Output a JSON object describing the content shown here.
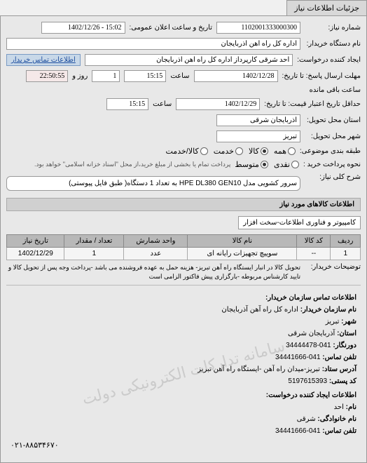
{
  "tab": {
    "title": "جزئیات اطلاعات نیاز"
  },
  "form": {
    "request_number_label": "شماره نیاز:",
    "request_number": "1102001333000300",
    "public_datetime_label": "تاریخ و ساعت اعلان عمومی:",
    "public_datetime": "15:02 - 1402/12/26",
    "buyer_org_label": "نام دستگاه خریدار:",
    "buyer_org": "اداره کل راه آهن آذربایجان",
    "requester_label": "ایجاد کننده درخواست:",
    "requester": "احد شرقی کارپرداز اداره کل راه آهن آذربایجان",
    "contact_link": "اطلاعات تماس خریدار",
    "response_deadline_label": "مهلت ارسال پاسخ: تا تاریخ:",
    "validity_deadline_label": "حداقل تاریخ اعتبار قیمت: تا تاریخ:",
    "date1": "1402/12/28",
    "date2": "1402/12/29",
    "time_label": "ساعت",
    "time1": "15:15",
    "time2": "15:15",
    "days_label": "روز و",
    "days_value": "1",
    "countdown": "22:50:55",
    "remaining": "ساعت باقی مانده",
    "province_label": "استان محل تحویل:",
    "province": "آذربایجان شرقی",
    "city_label": "شهر محل تحویل:",
    "city": "تبریز",
    "group_label": "طبقه بندی موضوعی:",
    "opt_all": "همه",
    "opt_goods": "کالا",
    "opt_service": "خدمت",
    "opt_both": "کالا/خدمت",
    "payment_label": "نحوه پرداخت خرید :",
    "opt_cash": "نقدی",
    "opt_medium": "متوسط",
    "payment_note": "پرداخت تمام یا بخشی از مبلغ خرید،از محل \"اسناد خزانه اسلامی\" خواهد بود.",
    "subject_label": "شرح کلی نیاز:",
    "subject": "سرور کشویی مدل HPE DL380 GEN10 به تعداد 1 دستگاه( طبق فایل پیوستی)"
  },
  "goods": {
    "section_title": "اطلاعات کالاهای مورد نیاز",
    "category": "کامپیوتر و فناوری اطلاعات-سخت افزار",
    "headers": {
      "row": "ردیف",
      "code": "کد کالا",
      "name": "نام کالا",
      "unit": "واحد شمارش",
      "qty": "تعداد / مقدار",
      "date": "تاریخ نیاز"
    },
    "rows": [
      {
        "row": "1",
        "code": "--",
        "name": "سوییچ تجهیزات رایانه ای",
        "unit": "عدد",
        "qty": "1",
        "date": "1402/12/29"
      }
    ],
    "delivery_label": "توضیحات خریدار:",
    "delivery_note": "تحویل کالا در انبار ایستگاه راه آهن تبریز- هزینه حمل به عهده فروشنده می باشد -پرداخت وجه پس از تحویل کالا و تایید کارشناس مربوطه -بارگزاری پیش فاکتور الزامی است"
  },
  "contact": {
    "title": "اطلاعات تماس سازمان خریدار:",
    "org_label": "نام سازمان خریدار:",
    "org": "اداره کل راه آهن آذربایجان",
    "city_label": "شهر:",
    "city": "تبریز",
    "province_label": "استان:",
    "province": "آذربایجان شرقی",
    "fax_label": "دورنگار:",
    "fax": "041-34444478",
    "phone_label": "تلفن تماس:",
    "phone": "041-34441666",
    "address_label": "آدرس ستاد:",
    "address": "تبریز-میدان راه آهن -ایستگاه راه آهن تبریز",
    "postal_label": "کد پستی:",
    "postal": "5197615393",
    "requester_title": "اطلاعات ایجاد کننده درخواست:",
    "name_label": "نام:",
    "name": "احد",
    "surname_label": "نام خانوادگی:",
    "surname": "شرقی",
    "req_phone_label": "تلفن تماس:",
    "req_phone": "041-34441666",
    "watermark": "سامانه تدارکات الکترونیکی دولت",
    "footer_phone": "۰۲۱-۸۸۵۳۴۶۷۰"
  }
}
